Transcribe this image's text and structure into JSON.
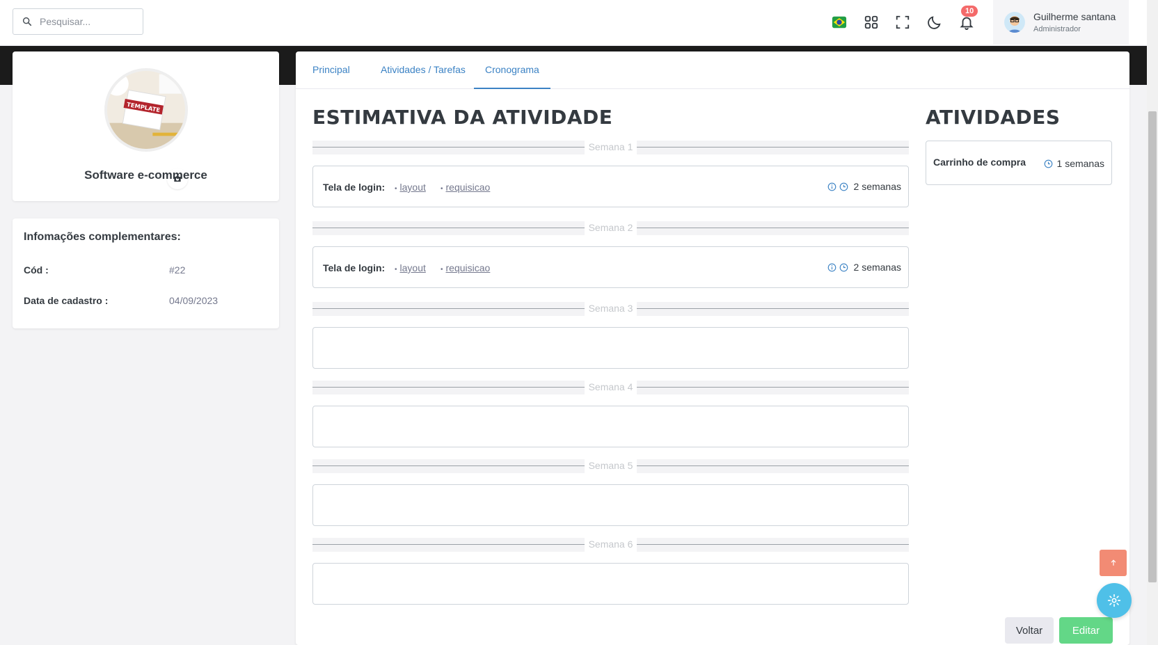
{
  "search": {
    "placeholder": "Pesquisar..."
  },
  "header": {
    "notifications_count": "10",
    "user": {
      "name": "Guilherme santana",
      "role": "Administrador"
    }
  },
  "profile": {
    "title": "Software e-commerce",
    "photo_text": "TEMPLATE"
  },
  "info": {
    "title": "Infomações complementares:",
    "rows": [
      {
        "label": "Cód :",
        "value": "#22"
      },
      {
        "label": "Data de cadastro :",
        "value": "04/09/2023"
      }
    ]
  },
  "tabs": [
    {
      "label": "Principal",
      "active": false
    },
    {
      "label": "Atividades / Tarefas",
      "active": false
    },
    {
      "label": "Cronograma",
      "active": true
    }
  ],
  "estimate": {
    "title": "ESTIMATIVA DA ATIVIDADE",
    "weeks": [
      {
        "label": "Semana 1",
        "task": {
          "name": "Tela de login:",
          "links": [
            "layout",
            "requisicao"
          ],
          "duration": "2 semanas"
        }
      },
      {
        "label": "Semana 2",
        "task": {
          "name": "Tela de login:",
          "links": [
            "layout",
            "requisicao"
          ],
          "duration": "2 semanas"
        }
      },
      {
        "label": "Semana 3"
      },
      {
        "label": "Semana 4"
      },
      {
        "label": "Semana 5"
      },
      {
        "label": "Semana 6"
      }
    ]
  },
  "activities": {
    "title": "ATIVIDADES",
    "items": [
      {
        "name": "Carrinho de compra",
        "duration": "1 semanas"
      }
    ]
  },
  "buttons": {
    "back": "Voltar",
    "edit": "Editar"
  },
  "colors": {
    "accent": "#3b82c4",
    "edit_button": "#63d787",
    "scroll_top": "#f28b74",
    "settings_fab": "#4fc0e8",
    "badge": "#f46a6a"
  },
  "icons": [
    "search-icon",
    "brazil-flag-icon",
    "apps-grid-icon",
    "fullscreen-icon",
    "moon-icon",
    "bell-icon",
    "camera-icon",
    "info-icon",
    "clock-icon",
    "arrow-up-icon",
    "gear-icon"
  ]
}
